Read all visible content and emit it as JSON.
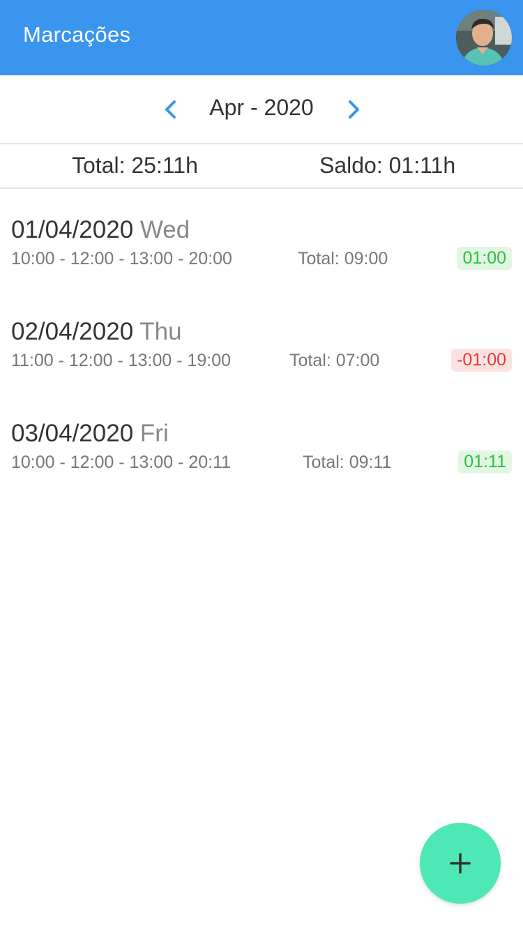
{
  "app_bar": {
    "title": "Marcações",
    "avatar_icon": "user-avatar",
    "color": "#3a95ee"
  },
  "month_nav": {
    "label": "Apr - 2020",
    "prev_icon": "chevron-left-icon",
    "next_icon": "chevron-right-icon",
    "arrow_color": "#3a95ee"
  },
  "summary": {
    "total": "Total: 25:11h",
    "saldo": "Saldo: 01:11h"
  },
  "entries": [
    {
      "date": "01/04/2020",
      "weekday": "Wed",
      "times": "10:00 - 12:00 - 13:00 - 20:00",
      "total": "Total: 09:00",
      "balance": "01:00",
      "balance_status": "positive"
    },
    {
      "date": "02/04/2020",
      "weekday": "Thu",
      "times": "11:00 - 12:00 - 13:00 - 19:00",
      "total": "Total: 07:00",
      "balance": "-01:00",
      "balance_status": "negative"
    },
    {
      "date": "03/04/2020",
      "weekday": "Fri",
      "times": "10:00 - 12:00 - 13:00 - 20:11",
      "total": "Total: 09:11",
      "balance": "01:11",
      "balance_status": "positive"
    }
  ],
  "fab": {
    "icon": "plus-icon",
    "color": "#4de8b5"
  }
}
